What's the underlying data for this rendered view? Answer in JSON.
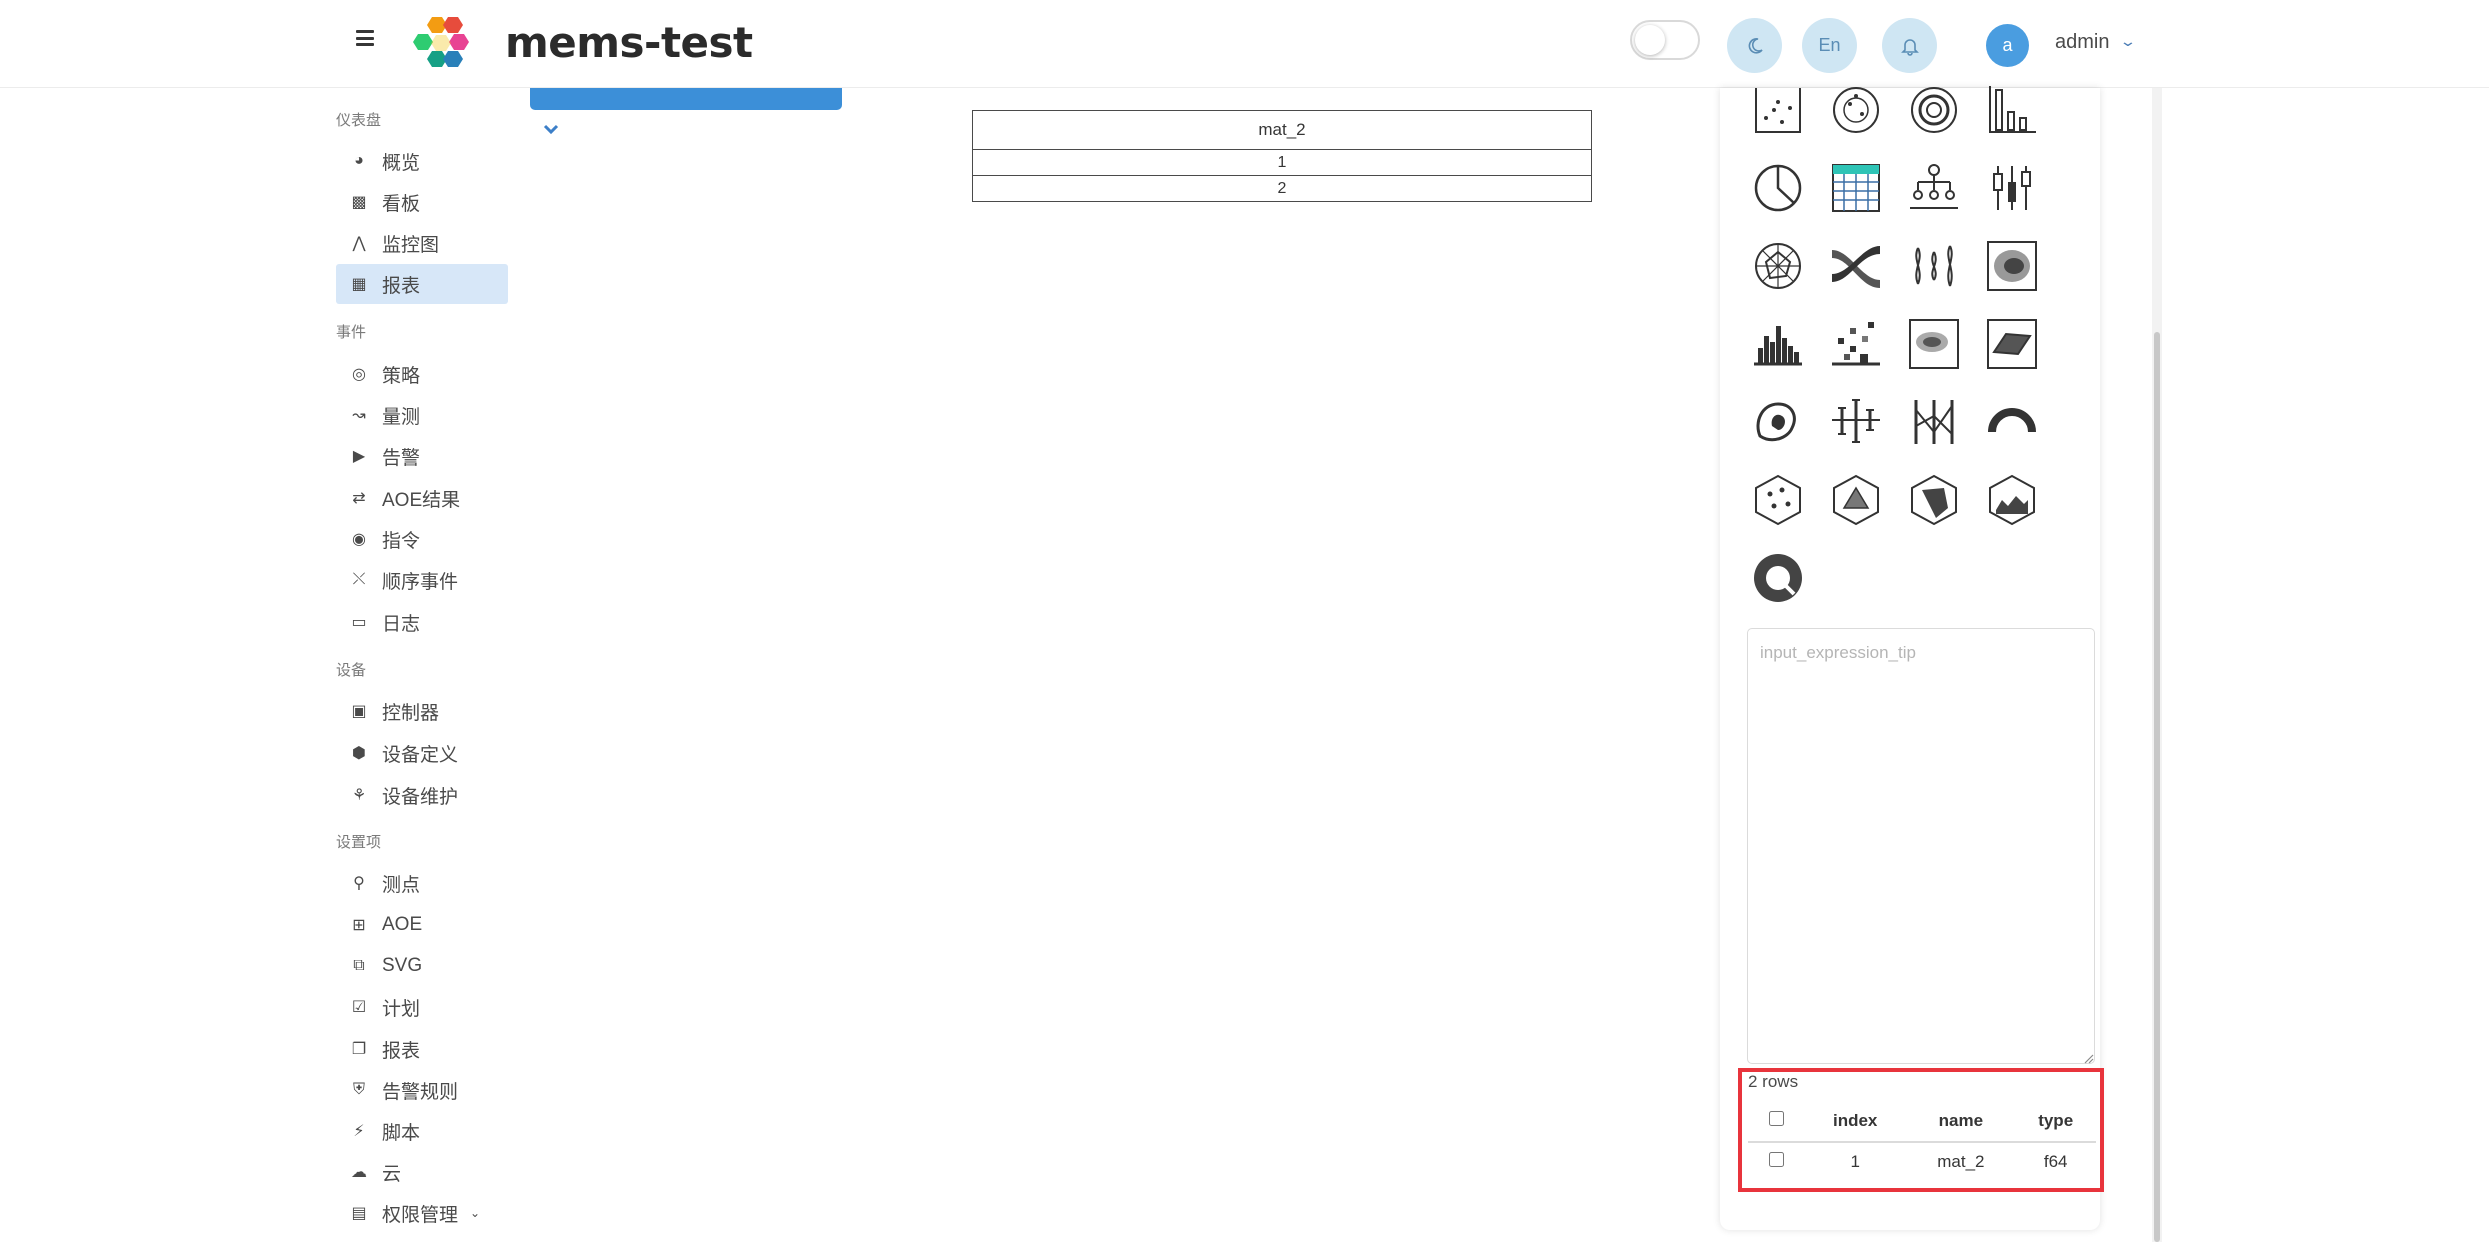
{
  "header": {
    "app_title": "mems-test",
    "lang_label": "En",
    "avatar_letter": "a",
    "user_name": "admin"
  },
  "sidebar": {
    "sections": [
      {
        "label": "仪表盘"
      },
      {
        "label": "事件"
      },
      {
        "label": "设备"
      },
      {
        "label": "设置项"
      }
    ],
    "items": [
      {
        "label": "概览",
        "icon": "dashboard-gauge-icon"
      },
      {
        "label": "看板",
        "icon": "board-icon"
      },
      {
        "label": "监控图",
        "icon": "sitemap-icon"
      },
      {
        "label": "报表",
        "icon": "table-icon",
        "active": true
      },
      {
        "label": "策略",
        "icon": "compass-icon"
      },
      {
        "label": "量测",
        "icon": "line-chart-icon"
      },
      {
        "label": "告警",
        "icon": "bullhorn-icon"
      },
      {
        "label": "AOE结果",
        "icon": "retweet-icon"
      },
      {
        "label": "指令",
        "icon": "podcast-icon"
      },
      {
        "label": "顺序事件",
        "icon": "shuffle-icon"
      },
      {
        "label": "日志",
        "icon": "book-icon"
      },
      {
        "label": "控制器",
        "icon": "expand-icon"
      },
      {
        "label": "设备定义",
        "icon": "cube-icon"
      },
      {
        "label": "设备维护",
        "icon": "cubes-icon"
      },
      {
        "label": "测点",
        "icon": "map-pin-icon"
      },
      {
        "label": "AOE",
        "icon": "network-icon"
      },
      {
        "label": "SVG",
        "icon": "clone-icon"
      },
      {
        "label": "计划",
        "icon": "calendar-check-icon"
      },
      {
        "label": "报表",
        "icon": "copy-icon"
      },
      {
        "label": "告警规则",
        "icon": "shield-icon"
      },
      {
        "label": "脚本",
        "icon": "plug-icon"
      },
      {
        "label": "云",
        "icon": "cloud-icon"
      },
      {
        "label": "权限管理",
        "icon": "id-card-icon"
      }
    ]
  },
  "main": {
    "result_table": {
      "header": "mat_2",
      "rows": [
        "1",
        "2"
      ]
    }
  },
  "right_panel": {
    "expression_placeholder": "input_expression_tip",
    "rows_count": "2 rows",
    "columns": [
      "index",
      "name",
      "type"
    ],
    "rows": [
      {
        "index": "1",
        "name": "mat_2",
        "type": "f64"
      }
    ]
  },
  "colors": {
    "accent": "#3c8fd8",
    "active_nav_bg": "#d7e7f8",
    "highlight_border": "#e8343c",
    "header_circle_bg": "#cfe6f3"
  }
}
